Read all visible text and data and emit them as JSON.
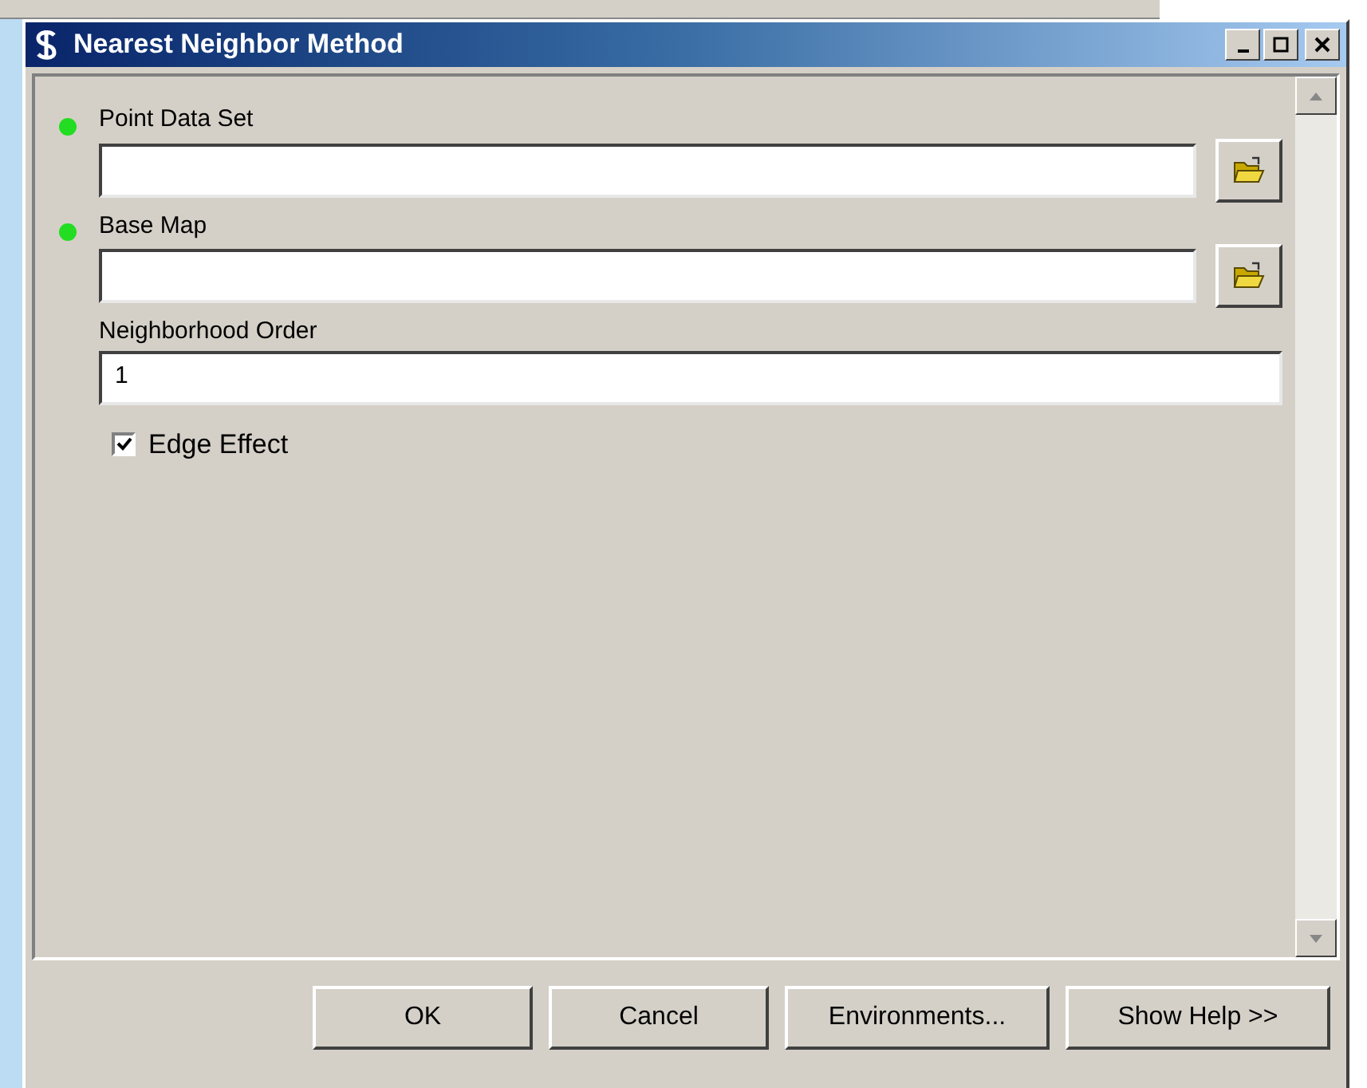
{
  "window": {
    "title": "Nearest Neighbor Method"
  },
  "parameters": [
    {
      "kind": "file",
      "label": "Point Data Set",
      "required": true
    },
    {
      "kind": "file",
      "label": "Base Map",
      "required": true
    },
    {
      "kind": "text",
      "label": "Neighborhood Order",
      "value": "1"
    },
    {
      "kind": "checkbox",
      "label": "Edge Effect",
      "checked": true
    }
  ],
  "buttons": [
    "OK",
    "Cancel",
    "Environments...",
    "Show Help >>"
  ]
}
